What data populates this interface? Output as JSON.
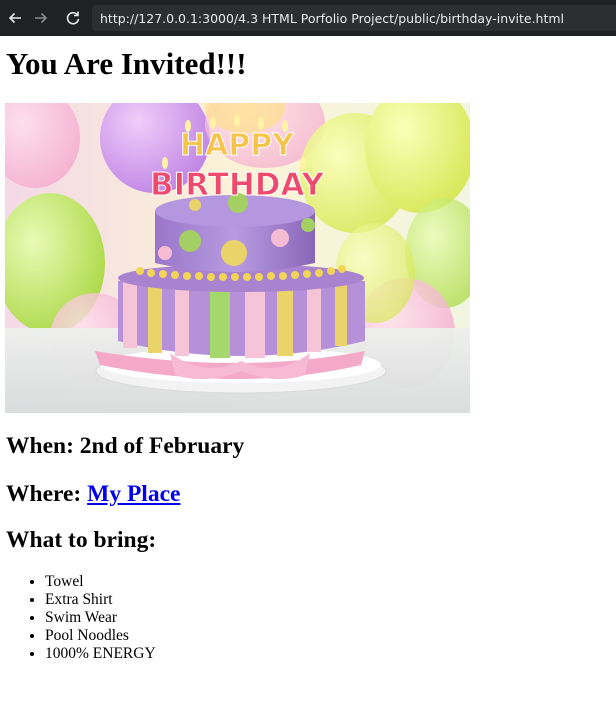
{
  "browser": {
    "url": "http://127.0.0.1:3000/4.3 HTML Porfolio Project/public/birthday-invite.html",
    "back_icon": "arrow-left-icon",
    "forward_icon": "arrow-right-icon",
    "reload_icon": "reload-icon"
  },
  "page": {
    "title": "You Are Invited!!!",
    "image_alt": "Birthday cake",
    "cake_text": [
      "HAPPY",
      "BIRTHDAY"
    ],
    "when_label": "When: 2nd of February",
    "where_label": "Where:",
    "where_link": "My Place",
    "bring_heading": "What to bring:",
    "bring_items": [
      "Towel",
      "Extra Shirt",
      "Swim Wear",
      "Pool Noodles",
      "1000% ENERGY"
    ]
  },
  "colors": {
    "browser_bar": "#202124",
    "link": "#0000ee"
  }
}
